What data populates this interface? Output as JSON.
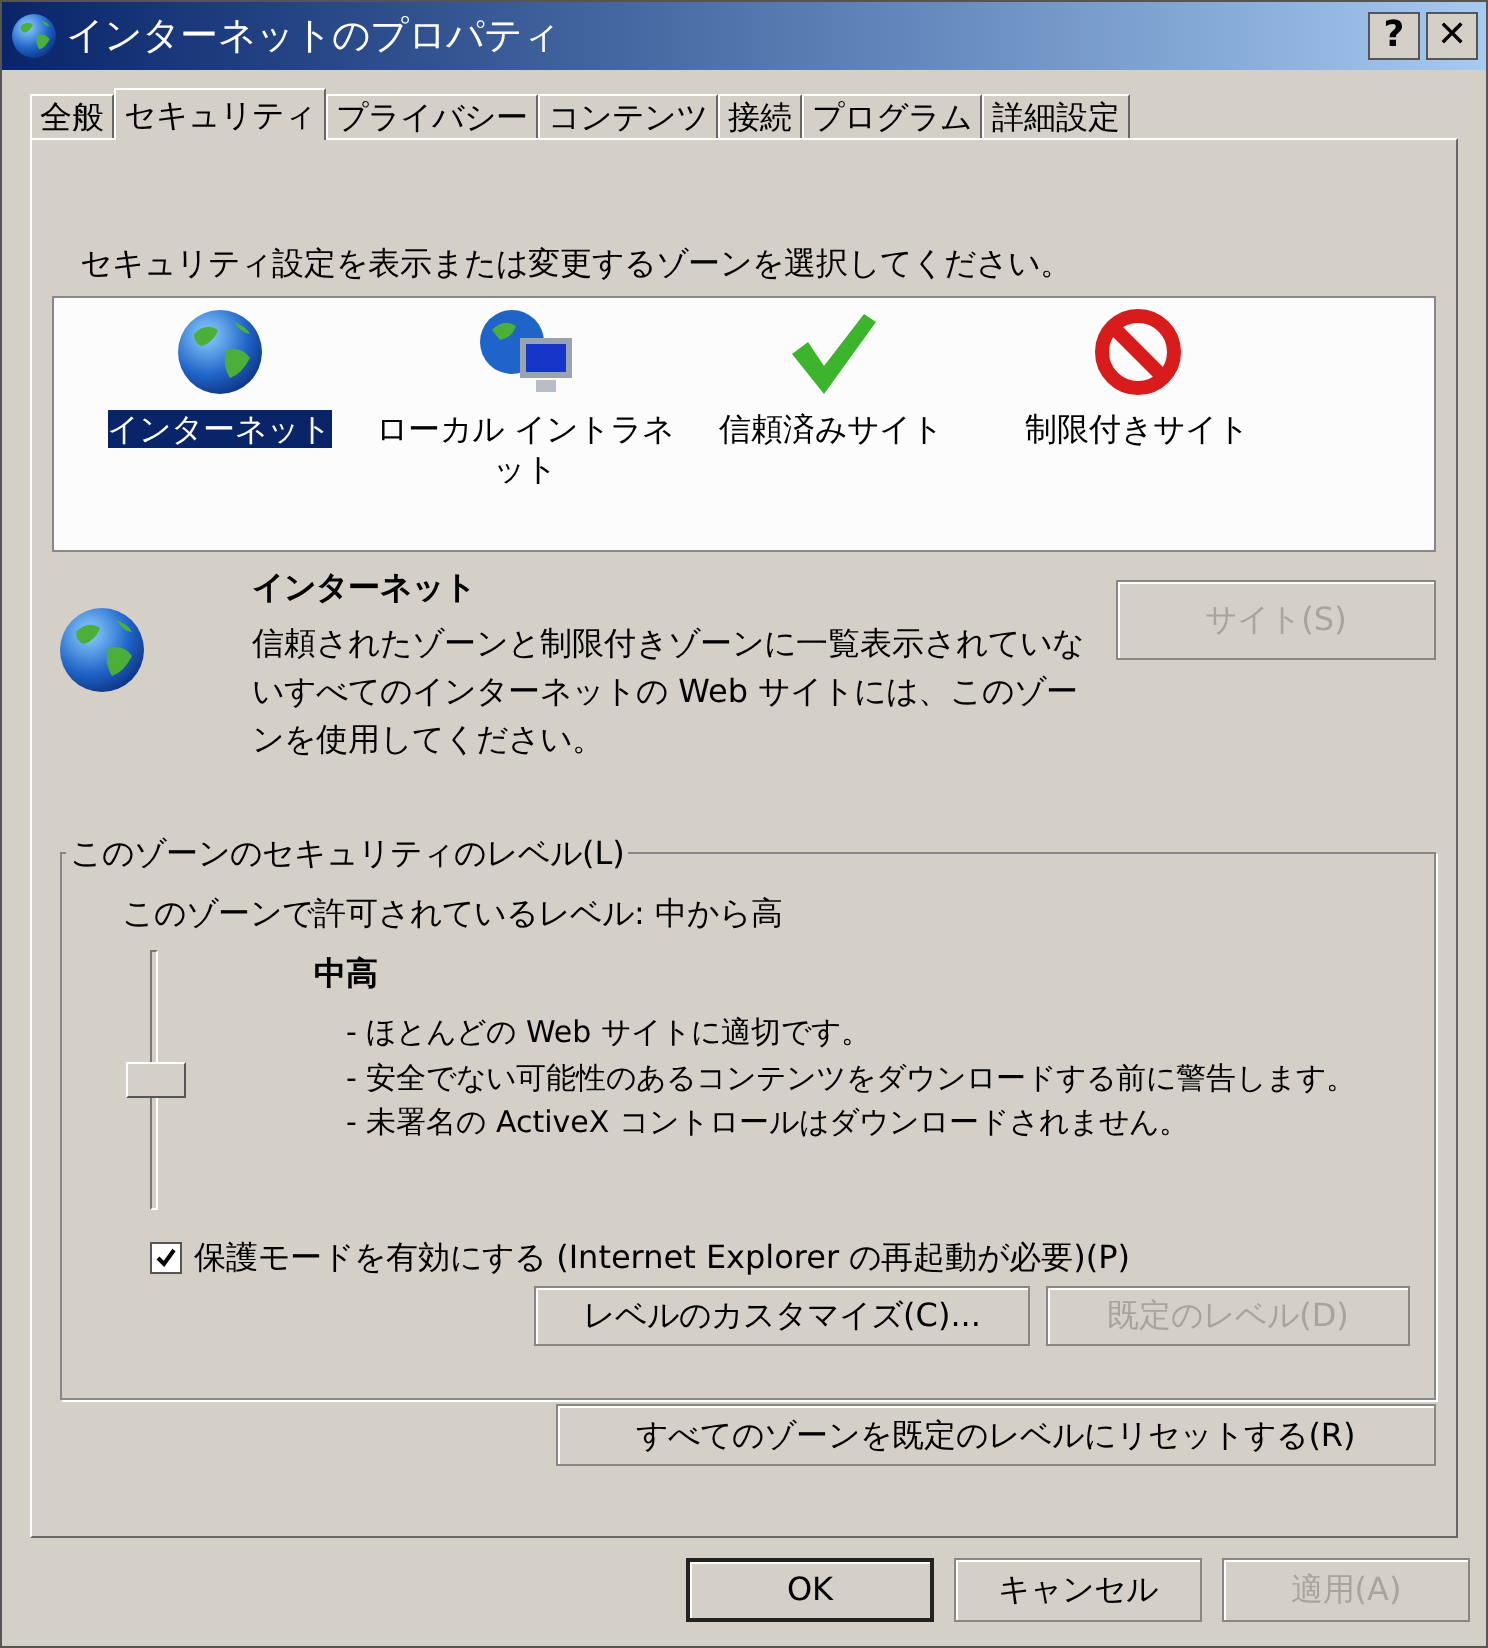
{
  "window": {
    "title": "インターネットのプロパティ",
    "help_button": "?",
    "close_button": "✕"
  },
  "tabs": [
    {
      "label": "全般",
      "selected": false
    },
    {
      "label": "セキュリティ",
      "selected": true
    },
    {
      "label": "プライバシー",
      "selected": false
    },
    {
      "label": "コンテンツ",
      "selected": false
    },
    {
      "label": "接続",
      "selected": false
    },
    {
      "label": "プログラム",
      "selected": false
    },
    {
      "label": "詳細設定",
      "selected": false
    }
  ],
  "zone_prompt": "セキュリティ設定を表示または変更するゾーンを選択してください。",
  "zones": [
    {
      "kind": "globe",
      "label": "インターネット",
      "selected": true
    },
    {
      "kind": "intranet",
      "label": "ローカル イントラネット",
      "selected": false
    },
    {
      "kind": "trusted",
      "label": "信頼済みサイト",
      "selected": false
    },
    {
      "kind": "restricted",
      "label": "制限付きサイト",
      "selected": false
    }
  ],
  "zone_info": {
    "kind": "globe",
    "title": "インターネット",
    "description": "信頼されたゾーンと制限付きゾーンに一覧表示されていないすべてのインターネットの Web サイトには、このゾーンを使用してください。",
    "sites_button": {
      "label": "サイト(S)",
      "disabled": true
    }
  },
  "security_level": {
    "legend": "このゾーンのセキュリティのレベル(L)",
    "allowed": "このゾーンで許可されているレベル: 中から高",
    "slider": {
      "level": 0.5
    },
    "level_name": "中高",
    "bullets": [
      "- ほとんどの Web サイトに適切です。",
      "- 安全でない可能性のあるコンテンツをダウンロードする前に警告します。",
      "- 未署名の ActiveX コントロールはダウンロードされません。"
    ],
    "protected_mode": {
      "label": "保護モードを有効にする (Internet Explorer の再起動が必要)(P)",
      "checked": true
    },
    "buttons": [
      {
        "label": "レベルのカスタマイズ(C)...",
        "disabled": false
      },
      {
        "label": "既定のレベル(D)",
        "disabled": true
      }
    ]
  },
  "reset_button": {
    "label": "すべてのゾーンを既定のレベルにリセットする(R)",
    "disabled": false
  },
  "dialog_buttons": [
    {
      "label": "OK",
      "disabled": false,
      "default": true
    },
    {
      "label": "キャンセル",
      "disabled": false,
      "default": false
    },
    {
      "label": "適用(A)",
      "disabled": true,
      "default": false
    }
  ]
}
